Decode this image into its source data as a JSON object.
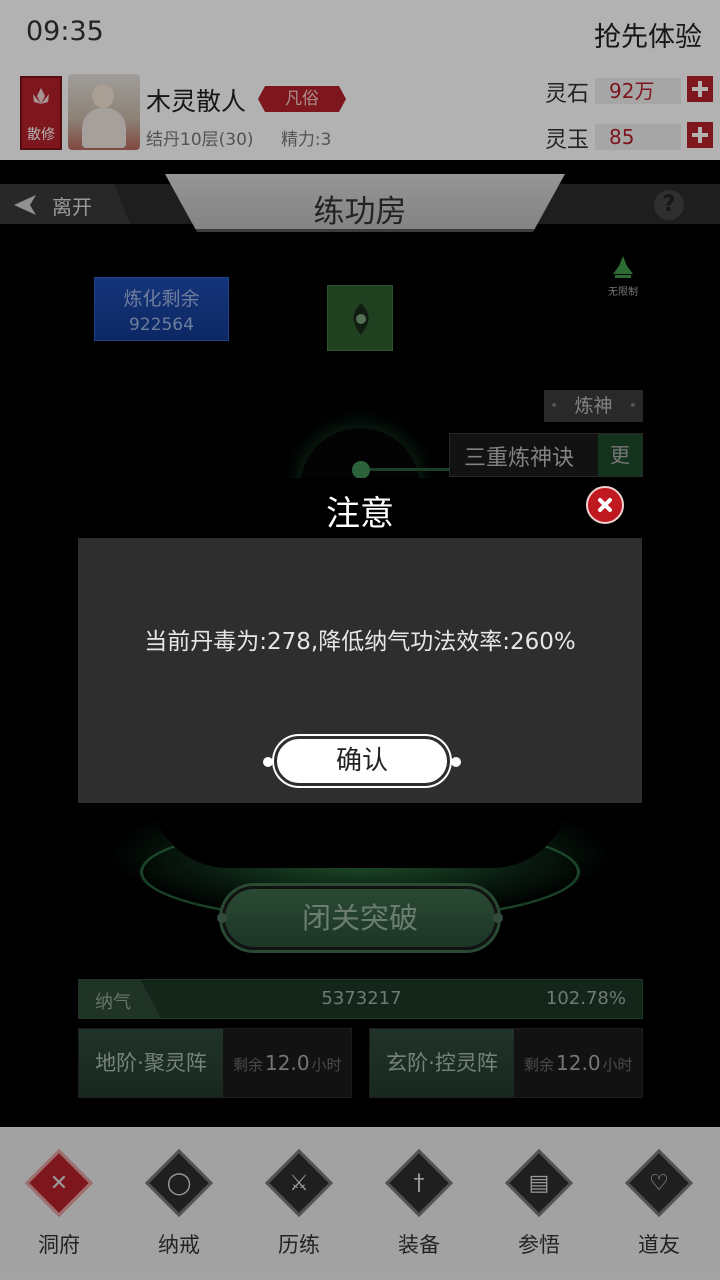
{
  "status": {
    "time": "09:35",
    "early_access": "抢先体验"
  },
  "player": {
    "sect": "散修",
    "name": "木灵散人",
    "realm_tag": "凡俗",
    "level": "结丹10层(30)",
    "energy": "精力:3"
  },
  "resources": [
    {
      "label": "灵石",
      "value": "92万"
    },
    {
      "label": "灵玉",
      "value": "85"
    }
  ],
  "header": {
    "back_label": "离开",
    "title": "练功房",
    "help": "?"
  },
  "refine": {
    "label": "炼化剩余",
    "value": "922564"
  },
  "unlimited_label": "无限制",
  "refine_spirit": "炼神",
  "technique": {
    "name": "三重炼神诀",
    "more": "更"
  },
  "breakthrough_label": "闭关突破",
  "qi": {
    "label": "纳气",
    "value": "5373217",
    "percent": "102.78%"
  },
  "arrays": [
    {
      "name": "地阶·聚灵阵",
      "remain_prefix": "剩余",
      "remain_value": "12.0",
      "unit": "小时"
    },
    {
      "name": "玄阶·控灵阵",
      "remain_prefix": "剩余",
      "remain_value": "12.0",
      "unit": "小时"
    }
  ],
  "nav": [
    {
      "label": "洞府",
      "icon": "cave-icon"
    },
    {
      "label": "纳戒",
      "icon": "ring-icon"
    },
    {
      "label": "历练",
      "icon": "crossed-swords-icon"
    },
    {
      "label": "装备",
      "icon": "dagger-icon"
    },
    {
      "label": "参悟",
      "icon": "book-icon"
    },
    {
      "label": "道友",
      "icon": "handshake-icon"
    }
  ],
  "modal": {
    "title": "注意",
    "message": "当前丹毒为:278,降低纳气功法效率:260%",
    "confirm": "确认"
  },
  "colors": {
    "accent_red": "#b3202a",
    "jade_green": "#2e5e2e",
    "modal_bg": "#2e2e2e"
  }
}
